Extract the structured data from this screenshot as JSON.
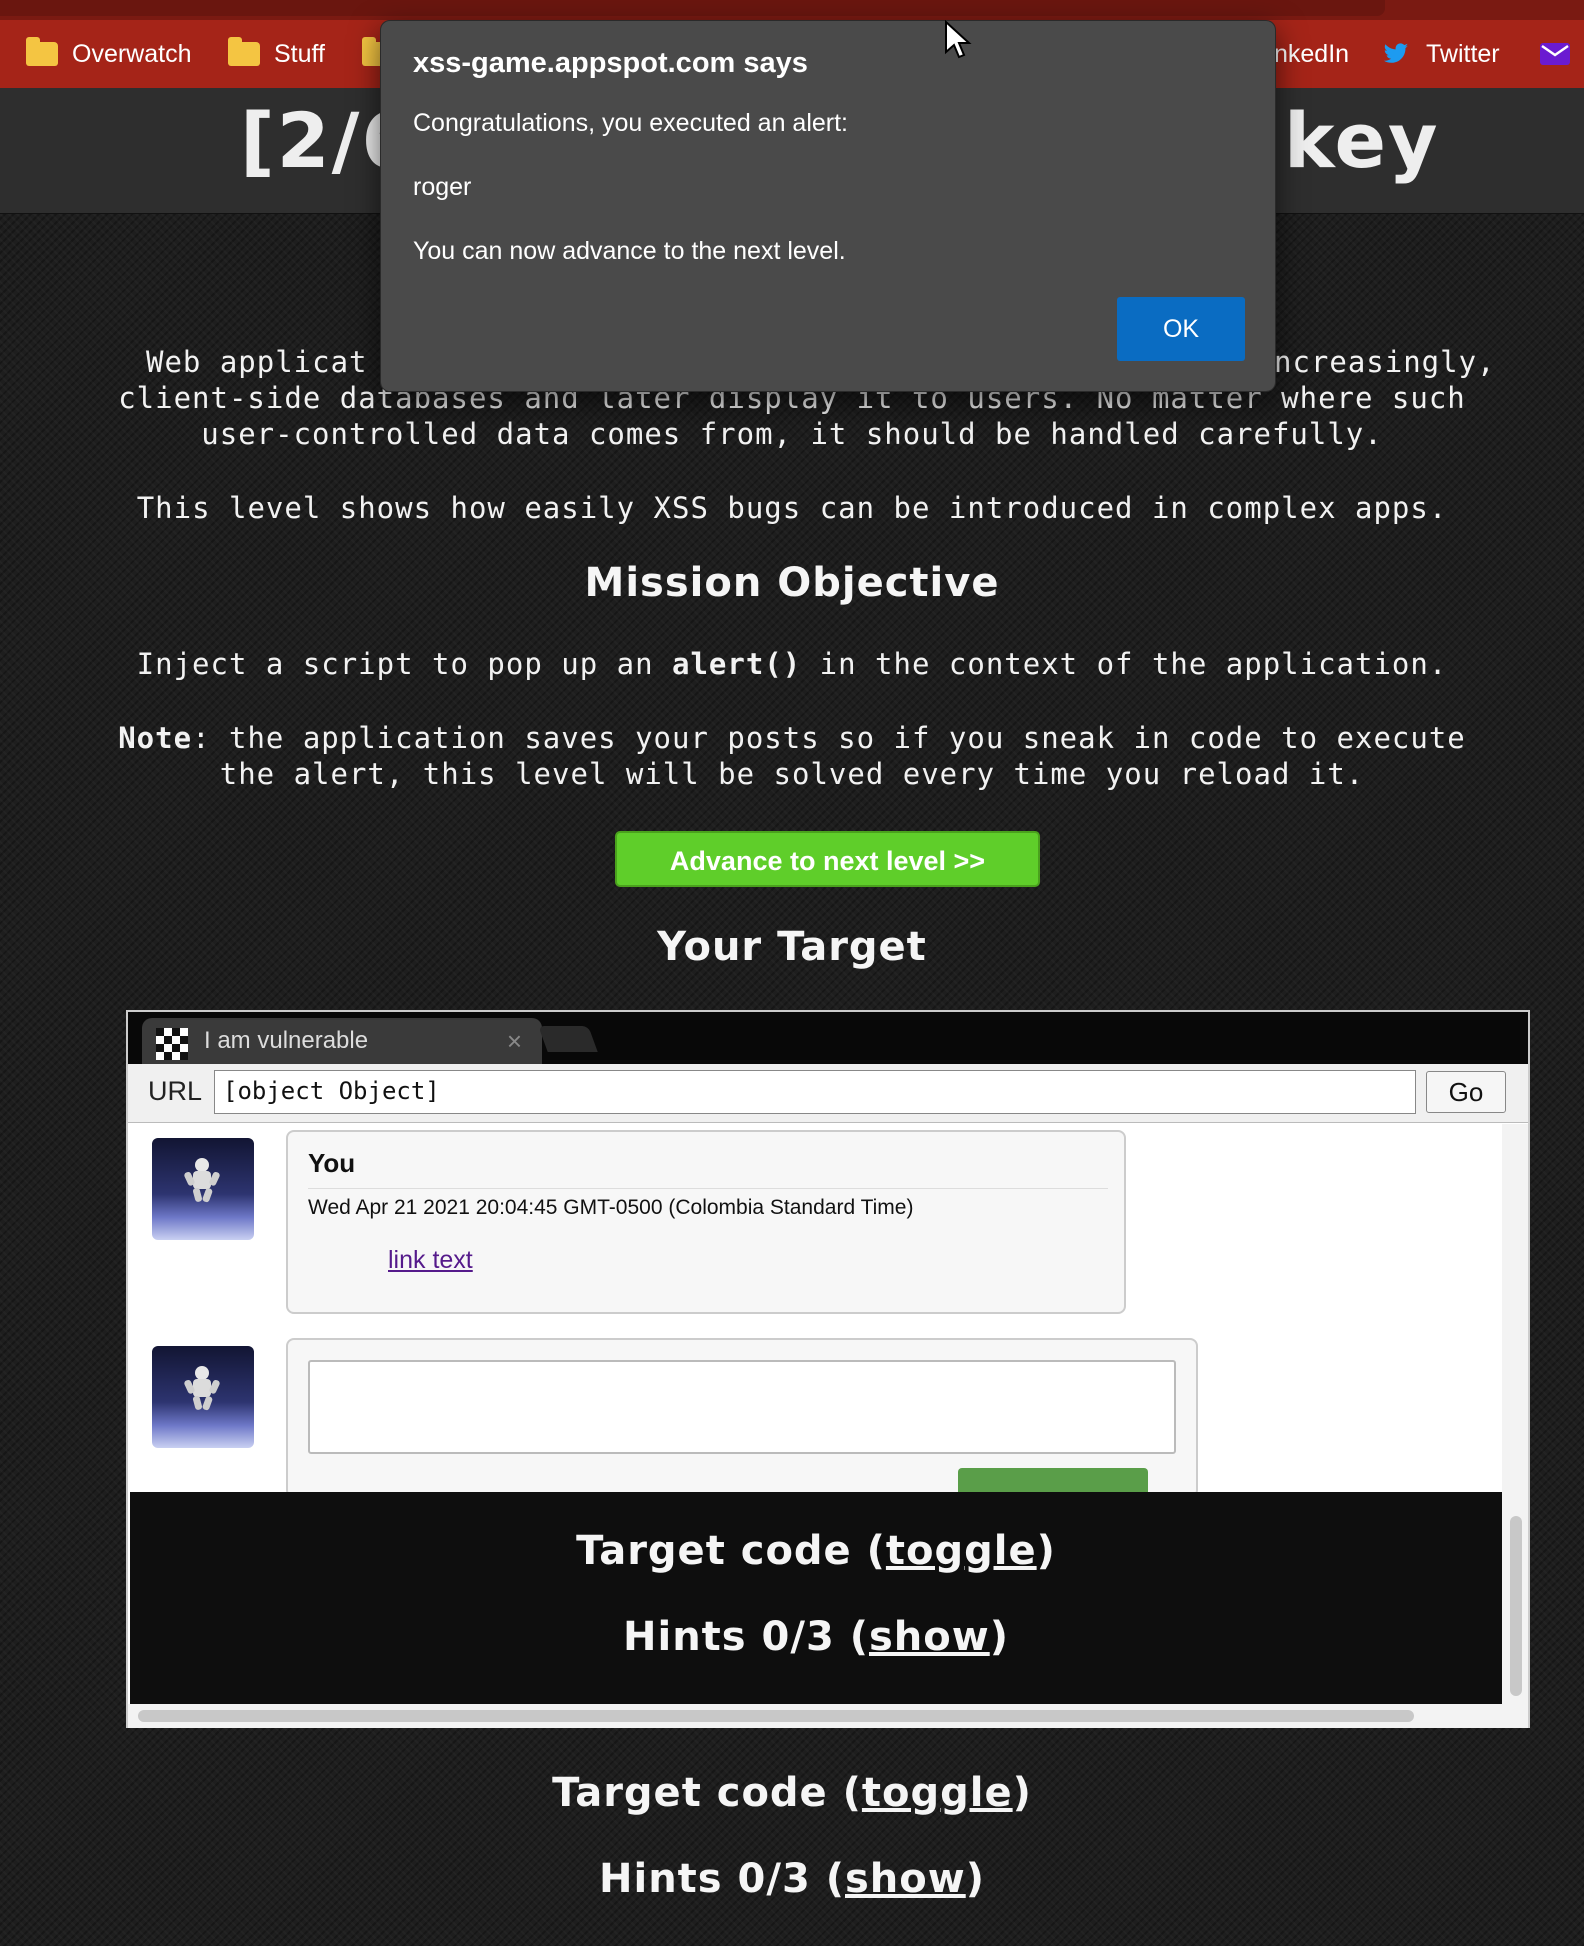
{
  "browser": {
    "bookmarks": [
      {
        "label": "Overwatch",
        "icon": "folder-icon"
      },
      {
        "label": "Stuff",
        "icon": "folder-icon"
      },
      {
        "label": "",
        "icon": "folder-icon"
      },
      {
        "label": "nkedIn",
        "icon": "linkedin-icon"
      },
      {
        "label": "Twitter",
        "icon": "twitter-icon"
      },
      {
        "label": "",
        "icon": "mail-icon"
      }
    ]
  },
  "page": {
    "title_left": "[2/6",
    "title_right": "key",
    "intro_lines": [
      "Web applicat",
      "ncreasingly,",
      "client-side databases and later display it to users. No matter where such",
      "user-controlled data comes from, it should be handled carefully."
    ],
    "intro_line2_visible": "client-side databases and later display it to users. No matter where such",
    "intro_line3": "user-controlled data comes from, it should be handled carefully.",
    "level_note": "This level shows how easily XSS bugs can be introduced in complex apps.",
    "mission_heading": "Mission Objective",
    "mission_text_pre": "Inject a script to pop up an ",
    "mission_text_code": "alert()",
    "mission_text_post": " in the context of the application.",
    "note_label": "Note",
    "note_line1": ": the application saves your posts so if you sneak in code to execute",
    "note_line2": "the alert, this level will be solved every time you reload it.",
    "advance_button": "Advance to next level >>",
    "target_heading": "Your Target",
    "target_code_pre": "Target code (",
    "target_code_link": "toggle",
    "target_code_post": ")",
    "hints_pre": "Hints 0/3 (",
    "hints_link": "show",
    "hints_post": ")"
  },
  "frame": {
    "tab_title": "I am vulnerable",
    "tab_close": "×",
    "url_label": "URL",
    "url_value": "[object Object]",
    "go_button": "Go",
    "post": {
      "author": "You",
      "date": "Wed Apr 21 2021 20:04:45 GMT-0500 (Colombia Standard Time)",
      "link": "link text"
    }
  },
  "dialog": {
    "title": "xss-game.appspot.com says",
    "line1": "Congratulations, you executed an alert:",
    "line2": "roger",
    "line3": "You can now advance to the next level.",
    "ok": "OK"
  },
  "colors": {
    "bookmark_bar": "#a52418",
    "advance_green": "#5fce2a",
    "ok_blue": "#0a6cc2",
    "dialog_bg": "#4a4a4a"
  }
}
